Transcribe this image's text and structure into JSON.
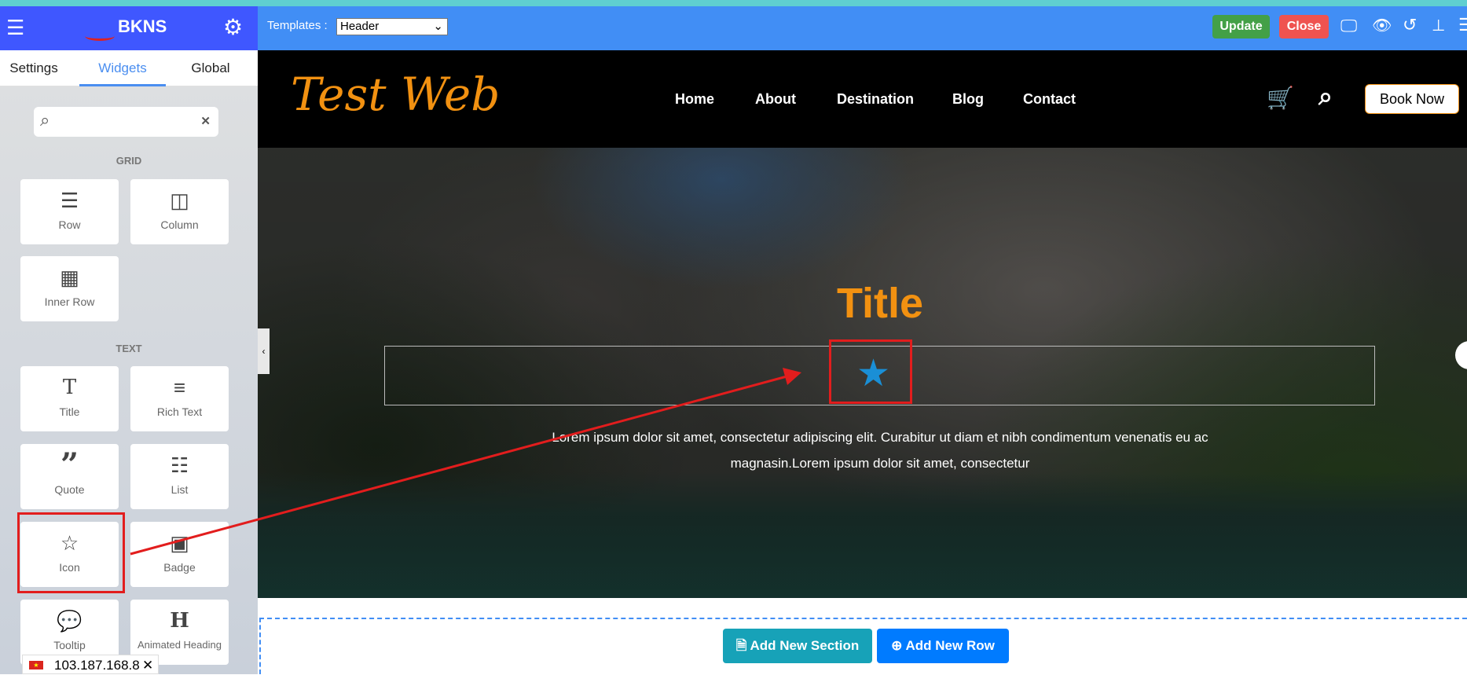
{
  "sidebar": {
    "brand": "BKNS",
    "tabs": [
      "Settings",
      "Widgets",
      "Global"
    ],
    "active_tab": "Widgets",
    "search": {
      "placeholder": "",
      "value": ""
    },
    "sections": [
      {
        "title": "GRID",
        "items": [
          "Row",
          "Column",
          "Inner Row"
        ]
      },
      {
        "title": "TEXT",
        "items": [
          "Title",
          "Rich Text",
          "Quote",
          "List",
          "Icon",
          "Badge",
          "Tooltip",
          "Animated Heading"
        ]
      }
    ]
  },
  "toolbar": {
    "templates_label": "Templates :",
    "template_selected": "Header",
    "update_label": "Update",
    "close_label": "Close",
    "colors": {
      "update": "#43a047",
      "close": "#ef5350",
      "header": "#418ef5",
      "sidebar_header": "#3f57ff"
    }
  },
  "site": {
    "logo": "Test Web",
    "nav": [
      "Home",
      "About",
      "Destination",
      "Blog",
      "Contact"
    ],
    "book_now": "Book Now",
    "hero": {
      "title": "Title",
      "icon": "star-icon",
      "text_line1": "Lorem ipsum dolor sit amet, consectetur adipiscing elit. Curabitur ut diam et nibh condimentum venenatis eu ac",
      "text_line2": "magnasin.Lorem ipsum dolor sit amet, consectetur"
    }
  },
  "actions": {
    "add_section": "Add New Section",
    "add_row": "Add New Row"
  },
  "ip_badge": "103.187.168.8"
}
